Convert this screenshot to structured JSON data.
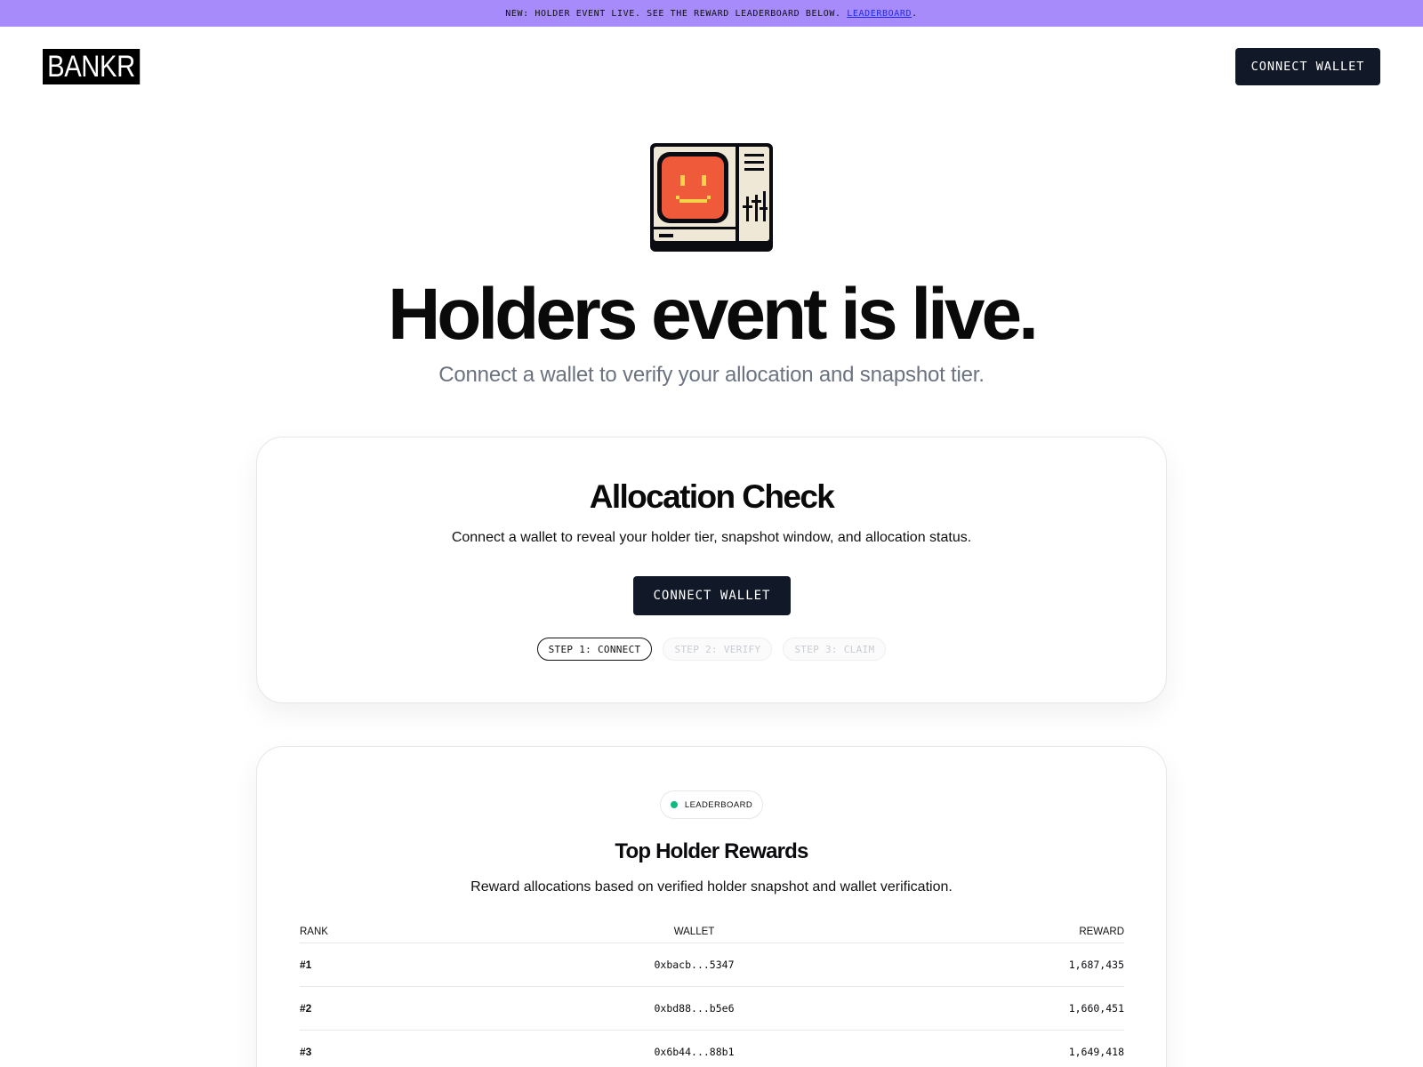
{
  "banner": {
    "text": "NEW: HOLDER EVENT LIVE. SEE THE REWARD LEADERBOARD BELOW.",
    "link": "LEADERBOARD",
    "suffix": "."
  },
  "header": {
    "logo": "BANKR",
    "connect_label": "CONNECT WALLET"
  },
  "hero": {
    "icon": "retro-computer-smiley-icon",
    "title": "Holders event is live.",
    "subtitle": "Connect a wallet to verify your allocation and snapshot tier."
  },
  "allocation": {
    "title": "Allocation Check",
    "description": "Connect a wallet to reveal your holder tier, snapshot window, and allocation status.",
    "connect_label": "CONNECT WALLET",
    "steps": [
      {
        "label": "STEP 1: CONNECT",
        "state": "active"
      },
      {
        "label": "STEP 2: VERIFY",
        "state": "disabled"
      },
      {
        "label": "STEP 3: CLAIM",
        "state": "disabled"
      }
    ]
  },
  "leaderboard": {
    "badge": "LEADERBOARD",
    "title": "Top Holder Rewards",
    "description": "Reward allocations based on verified holder snapshot and wallet verification.",
    "columns": {
      "rank": "RANK",
      "wallet": "WALLET",
      "reward": "REWARD"
    },
    "rows": [
      {
        "rank": "#1",
        "wallet": "0xbacb...5347",
        "reward": "1,687,435"
      },
      {
        "rank": "#2",
        "wallet": "0xbd88...b5e6",
        "reward": "1,660,451"
      },
      {
        "rank": "#3",
        "wallet": "0x6b44...88b1",
        "reward": "1,649,418"
      }
    ]
  },
  "colors": {
    "banner_bg": "#a78bfa",
    "button_bg": "#111827",
    "status_dot": "#10b981",
    "screen_face": "#ef5a3b",
    "face_features": "#f6d44a"
  }
}
